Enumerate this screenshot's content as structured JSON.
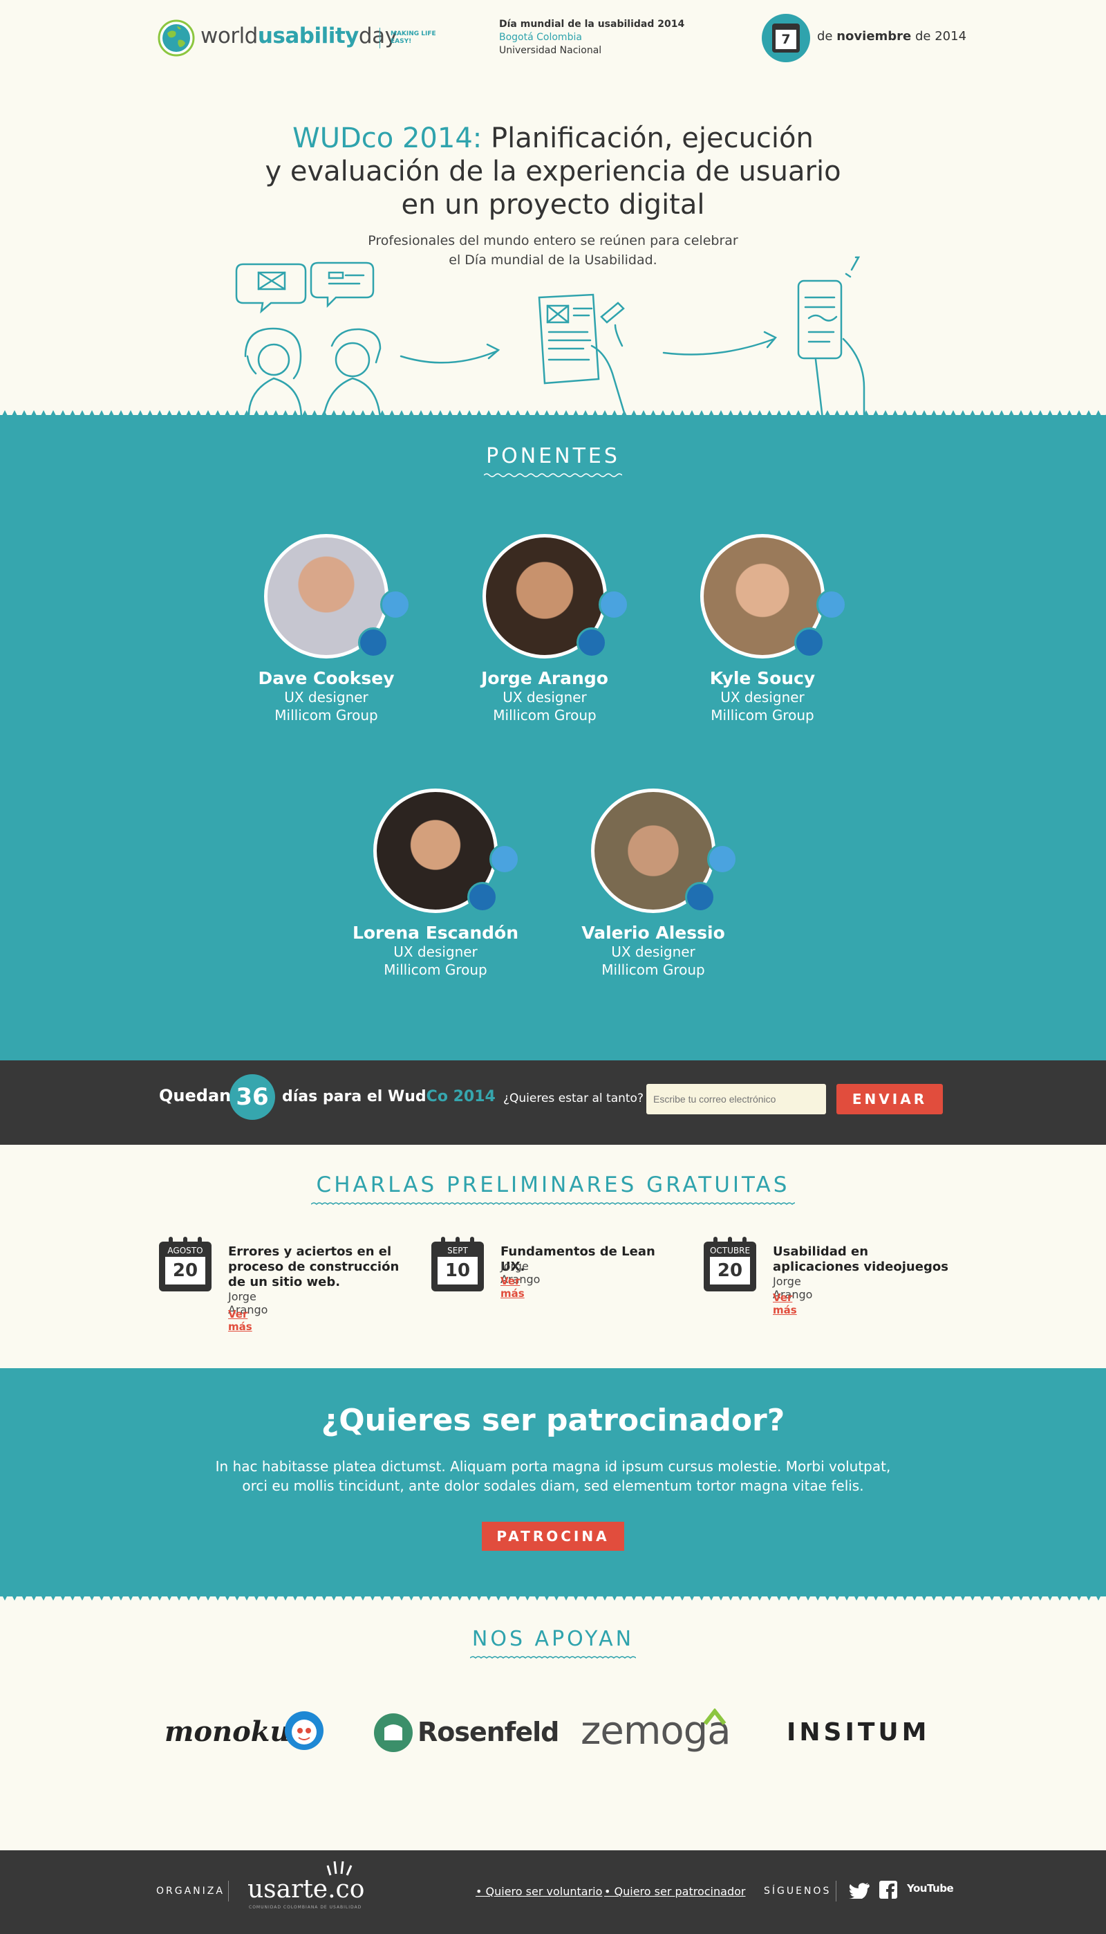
{
  "header": {
    "logo_world": "world",
    "logo_usability": "usability",
    "logo_day": "day",
    "logo_tagline": "MAKING LIFE EASY!",
    "event_title": "Día mundial de la usabilidad 2014",
    "event_city": "Bogotá Colombia",
    "event_venue": "Universidad Nacional",
    "date_day": "7",
    "date_prefix": "de",
    "date_month": "noviembre",
    "date_suffix": "de 2014"
  },
  "hero": {
    "title_accent": "WUDco 2014:",
    "title_line1": " Planificación, ejecución",
    "title_line2": "y evaluación de la experiencia de usuario",
    "title_line3": "en un proyecto digital",
    "subtitle_line1": "Profesionales del mundo entero se reúnen para celebrar",
    "subtitle_line2": "el Día mundial de la Usabilidad."
  },
  "speakers_section": {
    "title": "PONENTES",
    "speakers": [
      {
        "name": "Dave Cooksey",
        "role": "UX designer",
        "company": "Millicom Group"
      },
      {
        "name": "Jorge Arango",
        "role": "UX designer",
        "company": "Millicom Group"
      },
      {
        "name": "Kyle Soucy",
        "role": "UX designer",
        "company": "Millicom Group"
      },
      {
        "name": "Lorena Escandón",
        "role": "UX designer",
        "company": "Millicom Group"
      },
      {
        "name": "Valerio Alessio",
        "role": "UX designer",
        "company": "Millicom Group"
      }
    ]
  },
  "countdown": {
    "prefix": "Quedan",
    "days": "36",
    "suffix": "días para el",
    "brand_a": "Wud",
    "brand_b": "Co 2014",
    "question": "¿Quieres estar al tanto?",
    "email_placeholder": "Escribe tu correo electrónico",
    "button": "ENVIAR"
  },
  "talks_section": {
    "title": "CHARLAS PRELIMINARES GRATUITAS",
    "talks": [
      {
        "month": "AGOSTO",
        "day": "20",
        "title": "Errores y aciertos en el proceso de construcción de un sitio web.",
        "author": "Jorge Arango",
        "more": "Ver más"
      },
      {
        "month": "SEPT",
        "day": "10",
        "title": "Fundamentos de Lean UX.",
        "author": "Jorge Arango",
        "more": "Ver más"
      },
      {
        "month": "OCTUBRE",
        "day": "20",
        "title": "Usabilidad en aplicaciones videojuegos",
        "author": "Jorge Arango",
        "more": "Ver más"
      }
    ]
  },
  "sponsor_section": {
    "title": "¿Quieres ser patrocinador?",
    "text_line1": "In hac habitasse platea dictumst. Aliquam porta magna id ipsum cursus molestie. Morbi volutpat,",
    "text_line2": "orci eu mollis tincidunt, ante dolor sodales diam, sed elementum tortor magna vitae felis.",
    "button": "PATROCINA"
  },
  "supporters_section": {
    "title": "NOS APOYAN",
    "logos": [
      "monoku.",
      "Rosenfeld",
      "zemoga",
      "INSITUM"
    ]
  },
  "footer": {
    "organiza": "ORGANIZA",
    "org_name": "usarte.co",
    "org_sub": "COMUNIDAD COLOMBIANA DE USABILIDAD",
    "link_volunteer": "Quiero ser voluntario",
    "link_sponsor": "Quiero ser patrocinador",
    "siguenos": "SÍGUENOS",
    "youtube_label": "YouTube"
  },
  "colors": {
    "teal": "#36a6ae",
    "dark": "#383838",
    "red": "#e14d3d",
    "cream": "#fbfaf1"
  }
}
